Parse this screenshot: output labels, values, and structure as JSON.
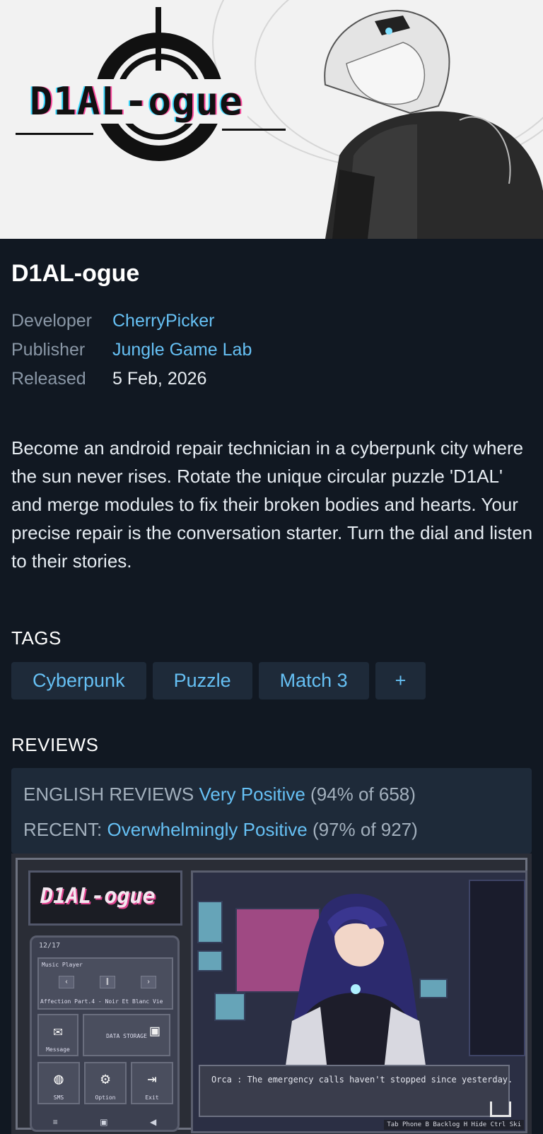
{
  "header": {
    "logo_text": "D1AL-ogue"
  },
  "game": {
    "title": "D1AL-ogue",
    "meta": [
      {
        "label": "Developer",
        "value": "CherryPicker",
        "link": true
      },
      {
        "label": "Publisher",
        "value": "Jungle Game Lab",
        "link": true
      },
      {
        "label": "Released",
        "value": "5 Feb, 2026",
        "link": false
      }
    ],
    "description": "Become an android repair technician in a cyberpunk city where the sun never rises. Rotate the unique circular puzzle 'D1AL' and merge modules to fix their broken bodies and hearts. Your precise repair is the conversation starter. Turn the dial and listen to their stories."
  },
  "tags": {
    "heading": "TAGS",
    "items": [
      "Cyberpunk",
      "Puzzle",
      "Match 3",
      "+"
    ]
  },
  "reviews": {
    "heading": "REVIEWS",
    "english_label": "ENGLISH REVIEWS",
    "english_summary": "Very Positive",
    "english_detail": "(94% of 658)",
    "recent_label": "RECENT:",
    "recent_summary": "Overwhelmingly Positive",
    "recent_detail": "(97% of 927)"
  },
  "screenshot": {
    "logo": "D1AL-ogue",
    "phone_time": "12/17",
    "music_label": "Music Player",
    "song": "Affection Part.4 - Noir Et Blanc Vie",
    "apps": [
      "Message",
      "DATA STORAGE",
      "SMS",
      "Option",
      "Exit"
    ],
    "dialog": "Orca : The emergency calls haven't stopped since yesterday.",
    "hotkeys": "Tab Phone B Backlog H Hide Ctrl Ski"
  },
  "colors": {
    "background": "#111822",
    "accent": "#66c0f4",
    "panel": "#1e2a39",
    "muted": "#8a97a6"
  }
}
